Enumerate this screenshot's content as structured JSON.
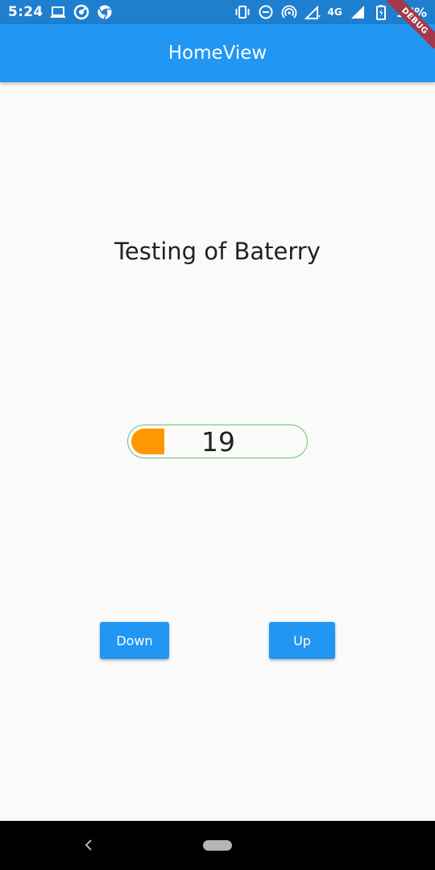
{
  "status_bar": {
    "time": "5:24",
    "network": "4G",
    "battery_percent": "17%",
    "left_icons": [
      "laptop-icon",
      "settings-icon",
      "chrome-icon"
    ],
    "right_icons": [
      "vibrate-icon",
      "do-not-disturb-icon",
      "hotspot-icon",
      "wifi-signal-icon",
      "cell-signal-icon",
      "battery-charging-icon"
    ]
  },
  "app_bar": {
    "title": "HomeView",
    "color": "#2196f3"
  },
  "debug_banner": "DEBUG",
  "main": {
    "heading": "Testing of Baterry",
    "battery_value": "19",
    "battery_level": 0.19,
    "battery_fill_color": "#ff9800",
    "down_label": "Down",
    "up_label": "Up"
  },
  "nav_bar": {
    "icons": [
      "back-icon",
      "home-pill-icon"
    ]
  }
}
